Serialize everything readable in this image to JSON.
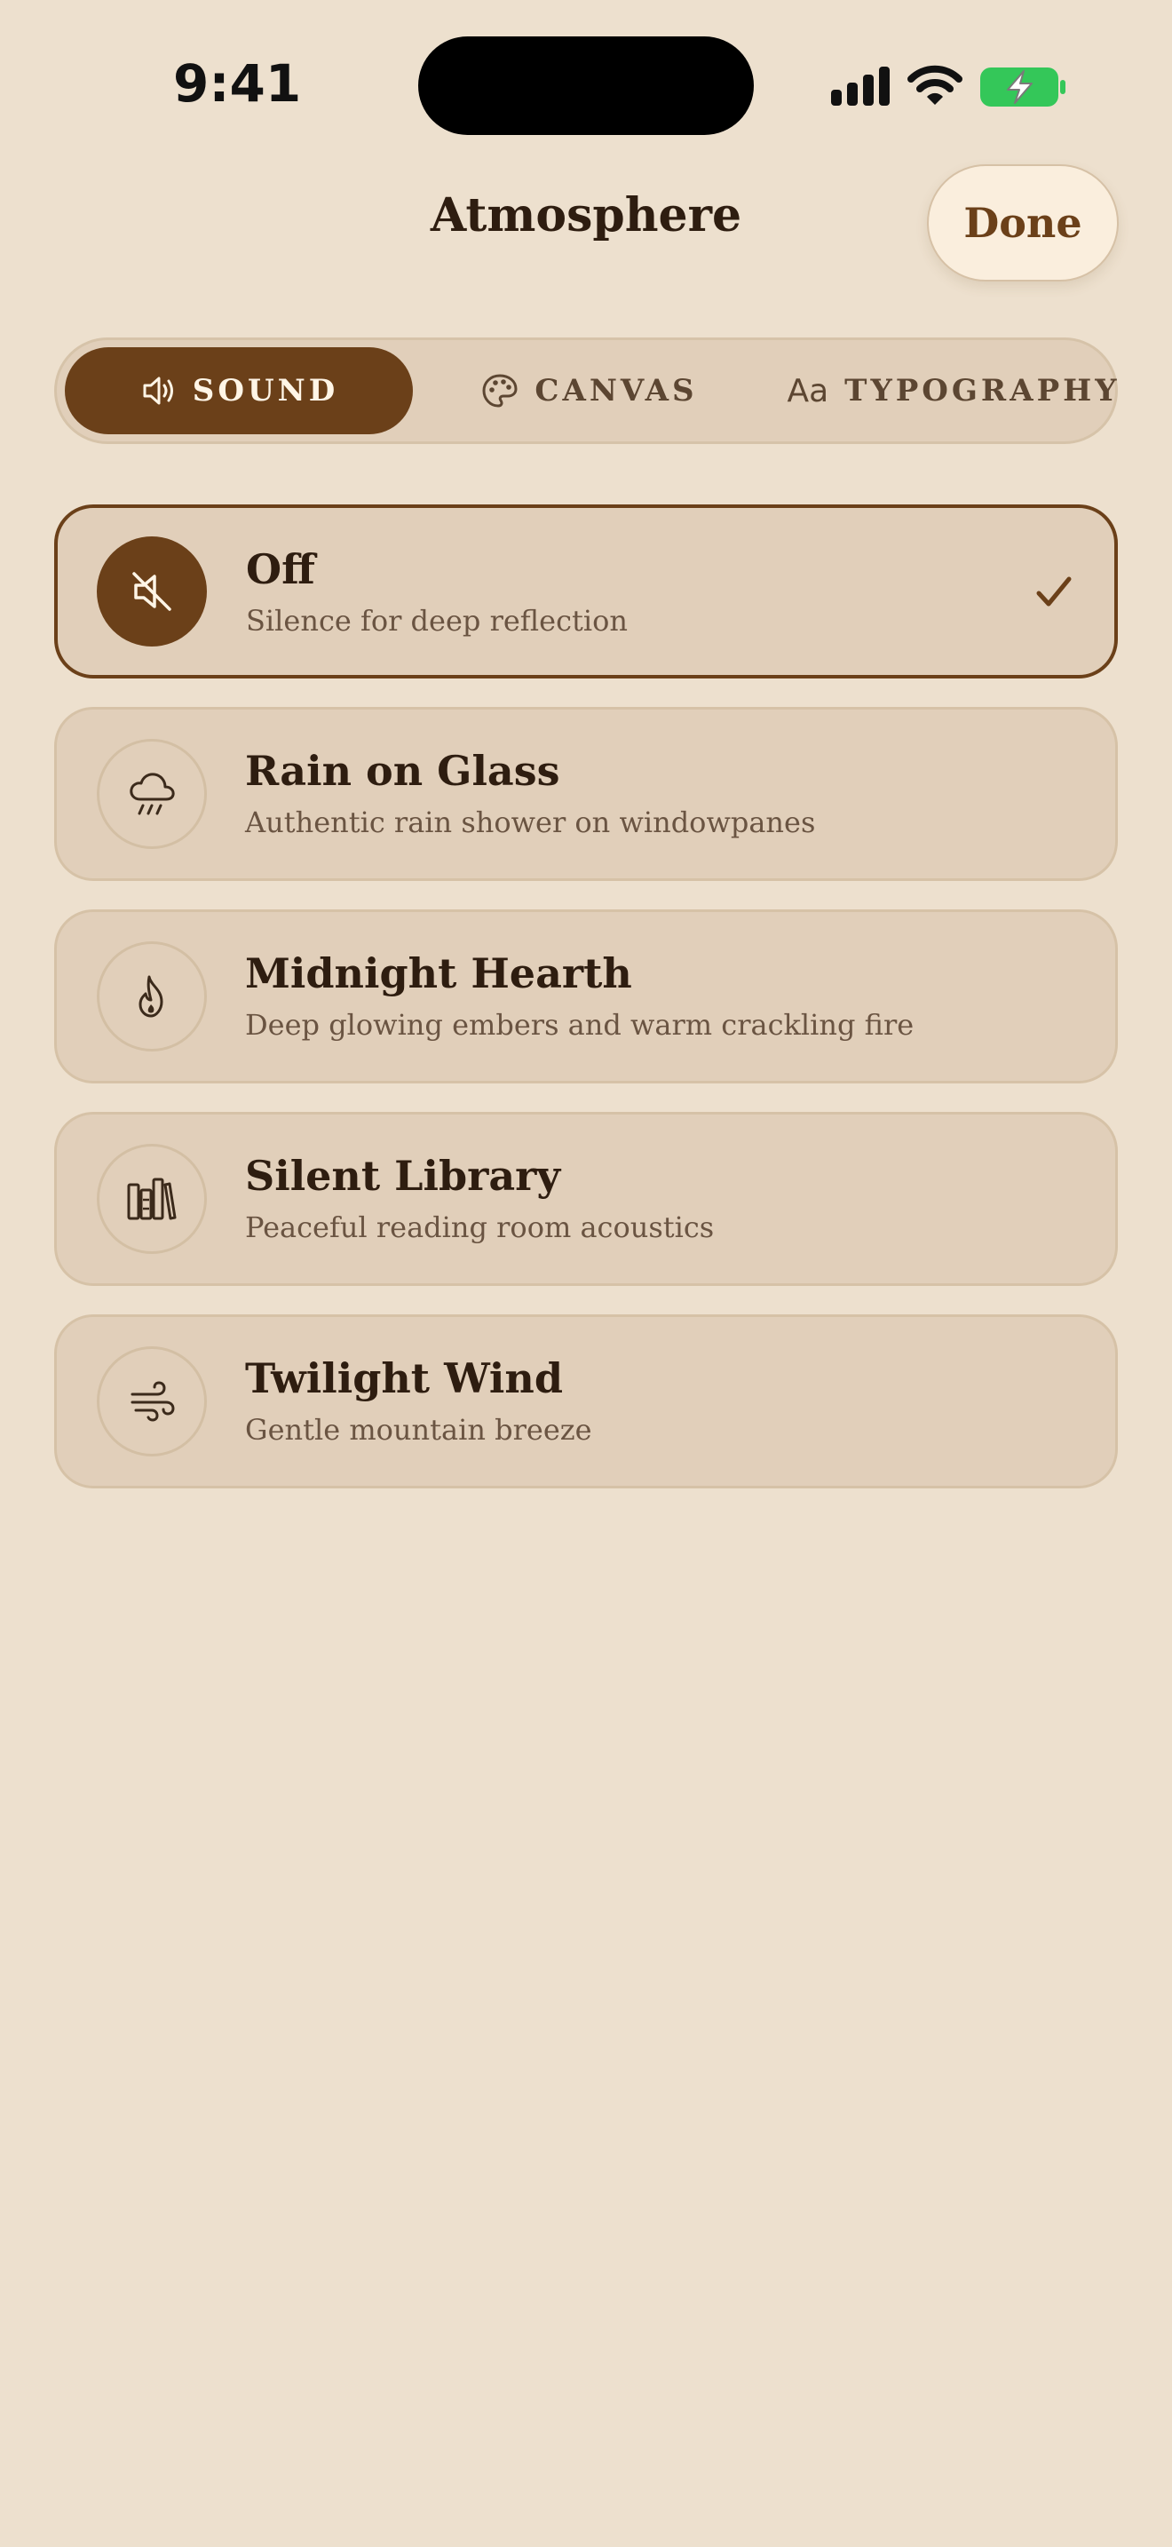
{
  "status_bar": {
    "time": "9:41",
    "icons": [
      "cellular-signal-icon",
      "wifi-icon",
      "battery-charging-icon"
    ]
  },
  "header": {
    "title": "Atmosphere",
    "done_label": "Done"
  },
  "tabs": [
    {
      "label": "SOUND",
      "icon": "speaker-icon",
      "active": true
    },
    {
      "label": "CANVAS",
      "icon": "palette-icon",
      "active": false
    },
    {
      "label": "TYPOGRAPHY",
      "icon": "text-aa-icon",
      "icon_text": "Aa",
      "active": false
    }
  ],
  "sounds": [
    {
      "title": "Off",
      "subtitle": "Silence for deep reflection",
      "icon": "speaker-muted-icon",
      "selected": true
    },
    {
      "title": "Rain on Glass",
      "subtitle": "Authentic rain shower on windowpanes",
      "icon": "cloud-rain-icon",
      "selected": false
    },
    {
      "title": "Midnight Hearth",
      "subtitle": "Deep glowing embers and warm crackling fire",
      "icon": "flame-icon",
      "selected": false
    },
    {
      "title": "Silent Library",
      "subtitle": "Peaceful reading room acoustics",
      "icon": "books-icon",
      "selected": false
    },
    {
      "title": "Twilight Wind",
      "subtitle": "Gentle mountain breeze",
      "icon": "wind-icon",
      "selected": false
    }
  ],
  "colors": {
    "background": "#EDE0CE",
    "accent": "#6B4019",
    "card": "#E1CFBA",
    "battery": "#34C759"
  }
}
